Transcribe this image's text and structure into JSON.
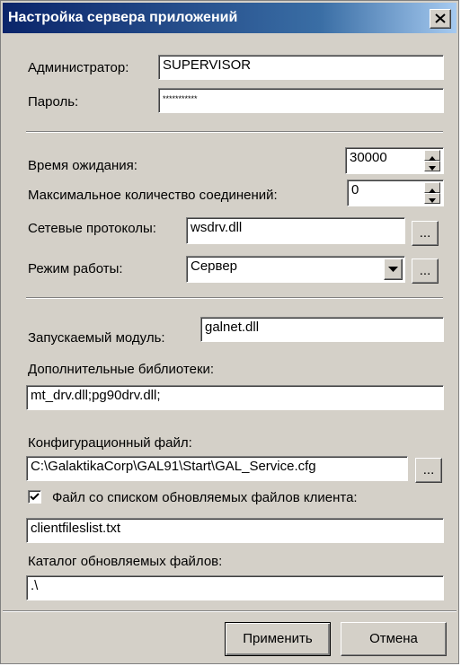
{
  "window": {
    "title": "Настройка сервера приложений"
  },
  "admin": {
    "label": "Администратор:",
    "value": "SUPERVISOR"
  },
  "password": {
    "label": "Пароль:",
    "value": "***********"
  },
  "timeout": {
    "label": "Время ожидания:",
    "value": "30000"
  },
  "max_connections": {
    "label": "Максимальное количество соединений:",
    "value": "0"
  },
  "protocols": {
    "label": "Сетевые протоколы:",
    "value": "wsdrv.dll",
    "browse_label": "..."
  },
  "mode": {
    "label": "Режим работы:",
    "value": "Сервер",
    "browse_label": "..."
  },
  "module": {
    "label": "Запускаемый модуль:",
    "value": "galnet.dll"
  },
  "libraries": {
    "label": "Дополнительные библиотеки:",
    "value": "mt_drv.dll;pg90drv.dll;"
  },
  "config": {
    "label": "Конфигурационный файл:",
    "value": "C:\\GalaktikaCorp\\GAL91\\Start\\GAL_Service.cfg",
    "browse_label": "..."
  },
  "client_files": {
    "checkbox_label": "Файл  со списком  обновляемых файлов клиента:",
    "checked": true,
    "value": "clientfileslist.txt"
  },
  "update_dir": {
    "label": "Каталог обновляемых файлов:",
    "value": ".\\"
  },
  "buttons": {
    "apply": "Применить",
    "cancel": "Отмена"
  }
}
